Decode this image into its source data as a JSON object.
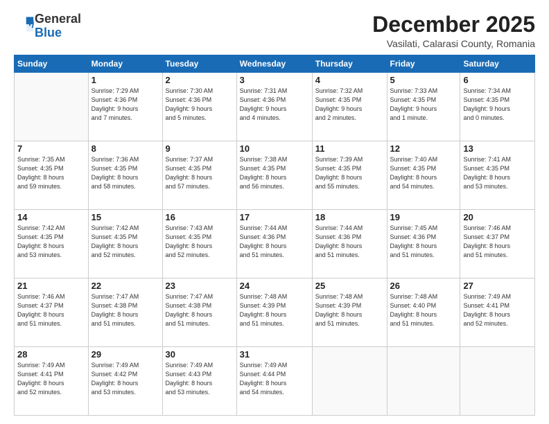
{
  "header": {
    "logo_general": "General",
    "logo_blue": "Blue",
    "month_title": "December 2025",
    "location": "Vasilati, Calarasi County, Romania"
  },
  "weekdays": [
    "Sunday",
    "Monday",
    "Tuesday",
    "Wednesday",
    "Thursday",
    "Friday",
    "Saturday"
  ],
  "weeks": [
    [
      {
        "day": "",
        "info": ""
      },
      {
        "day": "1",
        "info": "Sunrise: 7:29 AM\nSunset: 4:36 PM\nDaylight: 9 hours\nand 7 minutes."
      },
      {
        "day": "2",
        "info": "Sunrise: 7:30 AM\nSunset: 4:36 PM\nDaylight: 9 hours\nand 5 minutes."
      },
      {
        "day": "3",
        "info": "Sunrise: 7:31 AM\nSunset: 4:36 PM\nDaylight: 9 hours\nand 4 minutes."
      },
      {
        "day": "4",
        "info": "Sunrise: 7:32 AM\nSunset: 4:35 PM\nDaylight: 9 hours\nand 2 minutes."
      },
      {
        "day": "5",
        "info": "Sunrise: 7:33 AM\nSunset: 4:35 PM\nDaylight: 9 hours\nand 1 minute."
      },
      {
        "day": "6",
        "info": "Sunrise: 7:34 AM\nSunset: 4:35 PM\nDaylight: 9 hours\nand 0 minutes."
      }
    ],
    [
      {
        "day": "7",
        "info": "Sunrise: 7:35 AM\nSunset: 4:35 PM\nDaylight: 8 hours\nand 59 minutes."
      },
      {
        "day": "8",
        "info": "Sunrise: 7:36 AM\nSunset: 4:35 PM\nDaylight: 8 hours\nand 58 minutes."
      },
      {
        "day": "9",
        "info": "Sunrise: 7:37 AM\nSunset: 4:35 PM\nDaylight: 8 hours\nand 57 minutes."
      },
      {
        "day": "10",
        "info": "Sunrise: 7:38 AM\nSunset: 4:35 PM\nDaylight: 8 hours\nand 56 minutes."
      },
      {
        "day": "11",
        "info": "Sunrise: 7:39 AM\nSunset: 4:35 PM\nDaylight: 8 hours\nand 55 minutes."
      },
      {
        "day": "12",
        "info": "Sunrise: 7:40 AM\nSunset: 4:35 PM\nDaylight: 8 hours\nand 54 minutes."
      },
      {
        "day": "13",
        "info": "Sunrise: 7:41 AM\nSunset: 4:35 PM\nDaylight: 8 hours\nand 53 minutes."
      }
    ],
    [
      {
        "day": "14",
        "info": "Sunrise: 7:42 AM\nSunset: 4:35 PM\nDaylight: 8 hours\nand 53 minutes."
      },
      {
        "day": "15",
        "info": "Sunrise: 7:42 AM\nSunset: 4:35 PM\nDaylight: 8 hours\nand 52 minutes."
      },
      {
        "day": "16",
        "info": "Sunrise: 7:43 AM\nSunset: 4:35 PM\nDaylight: 8 hours\nand 52 minutes."
      },
      {
        "day": "17",
        "info": "Sunrise: 7:44 AM\nSunset: 4:36 PM\nDaylight: 8 hours\nand 51 minutes."
      },
      {
        "day": "18",
        "info": "Sunrise: 7:44 AM\nSunset: 4:36 PM\nDaylight: 8 hours\nand 51 minutes."
      },
      {
        "day": "19",
        "info": "Sunrise: 7:45 AM\nSunset: 4:36 PM\nDaylight: 8 hours\nand 51 minutes."
      },
      {
        "day": "20",
        "info": "Sunrise: 7:46 AM\nSunset: 4:37 PM\nDaylight: 8 hours\nand 51 minutes."
      }
    ],
    [
      {
        "day": "21",
        "info": "Sunrise: 7:46 AM\nSunset: 4:37 PM\nDaylight: 8 hours\nand 51 minutes."
      },
      {
        "day": "22",
        "info": "Sunrise: 7:47 AM\nSunset: 4:38 PM\nDaylight: 8 hours\nand 51 minutes."
      },
      {
        "day": "23",
        "info": "Sunrise: 7:47 AM\nSunset: 4:38 PM\nDaylight: 8 hours\nand 51 minutes."
      },
      {
        "day": "24",
        "info": "Sunrise: 7:48 AM\nSunset: 4:39 PM\nDaylight: 8 hours\nand 51 minutes."
      },
      {
        "day": "25",
        "info": "Sunrise: 7:48 AM\nSunset: 4:39 PM\nDaylight: 8 hours\nand 51 minutes."
      },
      {
        "day": "26",
        "info": "Sunrise: 7:48 AM\nSunset: 4:40 PM\nDaylight: 8 hours\nand 51 minutes."
      },
      {
        "day": "27",
        "info": "Sunrise: 7:49 AM\nSunset: 4:41 PM\nDaylight: 8 hours\nand 52 minutes."
      }
    ],
    [
      {
        "day": "28",
        "info": "Sunrise: 7:49 AM\nSunset: 4:41 PM\nDaylight: 8 hours\nand 52 minutes."
      },
      {
        "day": "29",
        "info": "Sunrise: 7:49 AM\nSunset: 4:42 PM\nDaylight: 8 hours\nand 53 minutes."
      },
      {
        "day": "30",
        "info": "Sunrise: 7:49 AM\nSunset: 4:43 PM\nDaylight: 8 hours\nand 53 minutes."
      },
      {
        "day": "31",
        "info": "Sunrise: 7:49 AM\nSunset: 4:44 PM\nDaylight: 8 hours\nand 54 minutes."
      },
      {
        "day": "",
        "info": ""
      },
      {
        "day": "",
        "info": ""
      },
      {
        "day": "",
        "info": ""
      }
    ]
  ]
}
